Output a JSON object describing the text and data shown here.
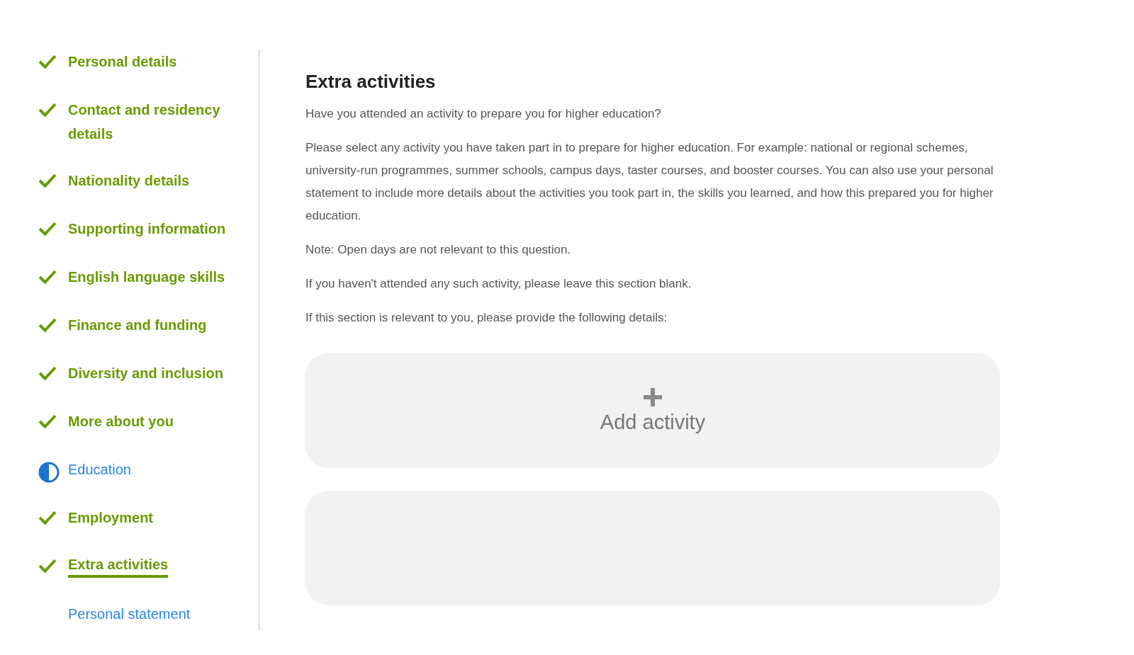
{
  "sidebar": {
    "items": [
      {
        "label": "Personal details",
        "kind": "complete",
        "selected": false
      },
      {
        "label": "Contact and residency details",
        "kind": "complete",
        "selected": false
      },
      {
        "label": "Nationality details",
        "kind": "complete",
        "selected": false
      },
      {
        "label": "Supporting information",
        "kind": "complete",
        "selected": false
      },
      {
        "label": "English language skills",
        "kind": "complete",
        "selected": false
      },
      {
        "label": "Finance and funding",
        "kind": "complete",
        "selected": false
      },
      {
        "label": "Diversity and inclusion",
        "kind": "complete",
        "selected": false
      },
      {
        "label": "More about you",
        "kind": "complete",
        "selected": false
      },
      {
        "label": "Education",
        "kind": "partial",
        "selected": false
      },
      {
        "label": "Employment",
        "kind": "complete",
        "selected": false
      },
      {
        "label": "Extra activities",
        "kind": "complete",
        "selected": true
      },
      {
        "label": "Personal statement",
        "kind": "empty",
        "selected": false
      }
    ]
  },
  "main": {
    "heading": "Extra activities",
    "paragraphs": [
      "Have you attended an activity to prepare you for higher education?",
      "Please select any activity you have taken part in to prepare for higher education. For example: national or regional schemes, university-run programmes, summer schools, campus days, taster courses, and booster courses. You can also use your personal statement to include more details about the activities you took part in, the skills you learned, and how this prepared you for higher education.",
      "Note: Open days are not relevant to this question.",
      "If you haven't attended any such activity, please leave this section blank.",
      "If this section is relevant to you, please provide the following details:"
    ],
    "add_button": {
      "label": "Add activity"
    }
  }
}
